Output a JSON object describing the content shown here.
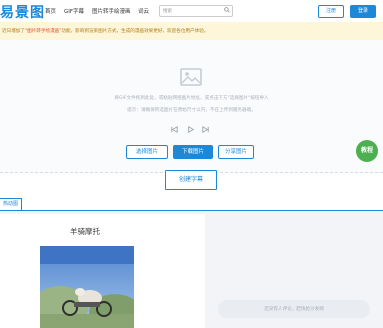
{
  "header": {
    "logo": "易景图",
    "nav": [
      "首页",
      "GIF字幕",
      "图片转手绘漫画",
      "词云"
    ],
    "search_placeholder": "搜索",
    "register_label": "注册",
    "login_label": "登录"
  },
  "notice": {
    "prefix": "近日增加了",
    "highlight": "\"图片转手绘漫画\"",
    "suffix": "功能，影响到渲染图片方式，生成的漫画效果更好，欢迎各位用户体验。"
  },
  "upload": {
    "hint_line1": "将GIF文件拖到此处，或粘贴网络图片地址，或点击下方\"选择图片\"按钮导入",
    "hint_line2": "提示：请确保所选图片在原始尺寸以内，不在上传到服务器端。"
  },
  "actions": {
    "select_image": "选择图片",
    "download_image": "下载图片",
    "share_image": "分享图片",
    "tutorial": "教程",
    "create_caption": "创建字幕"
  },
  "tabs": {
    "active": "热动图"
  },
  "gallery": {
    "title": "羊骑摩托"
  },
  "comment": {
    "placeholder": "还没有人评论，赶快抢沙发啊"
  },
  "colors": {
    "accent": "#1e88d8",
    "notice_bg": "#fdf6d8",
    "tutorial_green": "#4caf50"
  }
}
